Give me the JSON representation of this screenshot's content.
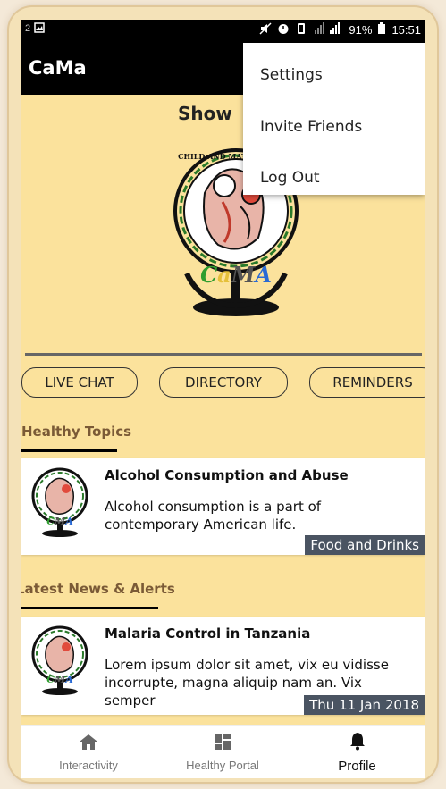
{
  "status_bar": {
    "left": "2",
    "battery": "91%",
    "time": "15:51"
  },
  "app_bar": {
    "title": "CaMa"
  },
  "main": {
    "heading": "Show",
    "logo": {
      "ring_text": "CHILD AND MATERNAL APP",
      "letters": "CaMA"
    }
  },
  "buttons": [
    {
      "label": "LIVE CHAT"
    },
    {
      "label": "DIRECTORY"
    },
    {
      "label": "REMINDERS"
    }
  ],
  "sections": {
    "healthy_topics": {
      "heading": "Healthy Topics",
      "card": {
        "title": "Alcohol Consumption and Abuse",
        "body": "Alcohol consumption is a part of contemporary American life.",
        "tag": "Food and Drinks"
      }
    },
    "news": {
      "heading": "Latest News & Alerts",
      "card": {
        "title": "Malaria Control in Tanzania",
        "body": "Lorem ipsum dolor sit amet, vix eu vidisse incorrupte, magna aliquip nam an. Vix semper",
        "tag": "Thu 11 Jan 2018"
      }
    }
  },
  "bottom_nav": [
    {
      "label": "Interactivity",
      "icon": "home-icon"
    },
    {
      "label": "Healthy Portal",
      "icon": "dashboard-icon"
    },
    {
      "label": "Profile",
      "icon": "bell-icon",
      "active": true
    }
  ],
  "overflow_menu": [
    {
      "label": "Settings"
    },
    {
      "label": "Invite Friends"
    },
    {
      "label": "Log Out"
    }
  ]
}
